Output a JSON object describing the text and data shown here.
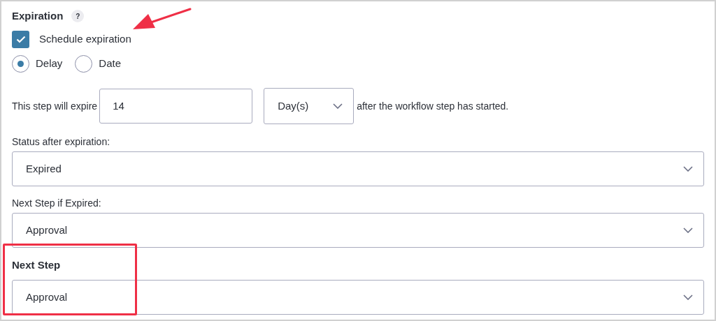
{
  "section": {
    "title": "Expiration",
    "help": "?"
  },
  "schedule": {
    "label": "Schedule expiration",
    "checked": true
  },
  "mode": [
    {
      "label": "Delay",
      "selected": true
    },
    {
      "label": "Date",
      "selected": false
    }
  ],
  "expire_row": {
    "prefix": "This step will expire",
    "amount": "14",
    "unit": "Day(s)",
    "suffix": "after the workflow step has started."
  },
  "selects": [
    {
      "label": "Status after expiration:",
      "value": "Expired",
      "bold": false
    },
    {
      "label": "Next Step if Expired:",
      "value": "Approval",
      "bold": false
    },
    {
      "label": "Next Step",
      "value": "Approval",
      "bold": true
    }
  ]
}
